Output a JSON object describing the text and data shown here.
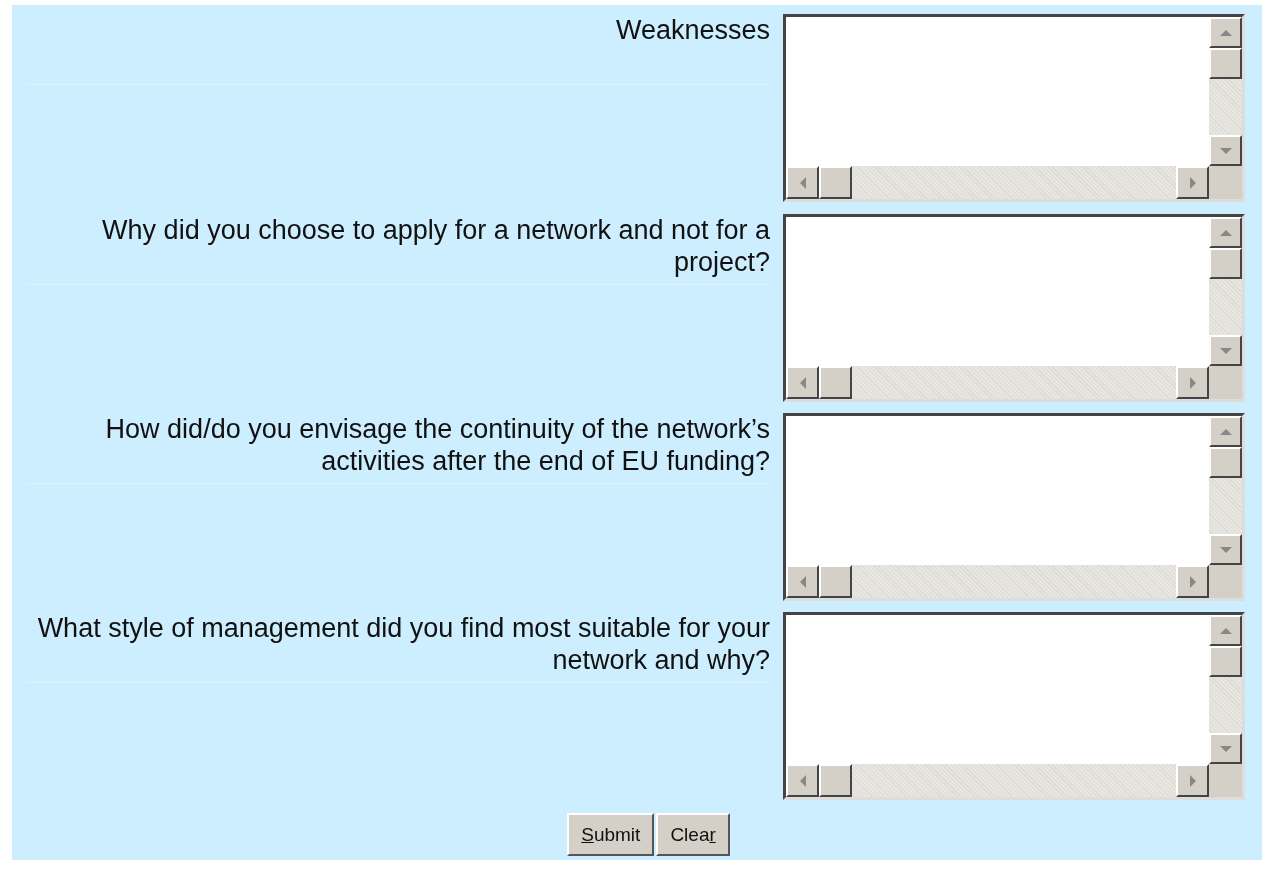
{
  "questions": [
    {
      "label": "Weaknesses"
    },
    {
      "label": "Why did you choose to apply for a network and not for a project?"
    },
    {
      "label": "How did/do you envisage the continuity of the network’s activities after the end of EU funding?"
    },
    {
      "label": "What style of management did you find most suitable for your network and why?"
    }
  ],
  "buttons": [
    {
      "access_key": "S",
      "text_after": "ubmit"
    },
    {
      "text_before": "Clea",
      "access_key": "r"
    }
  ]
}
